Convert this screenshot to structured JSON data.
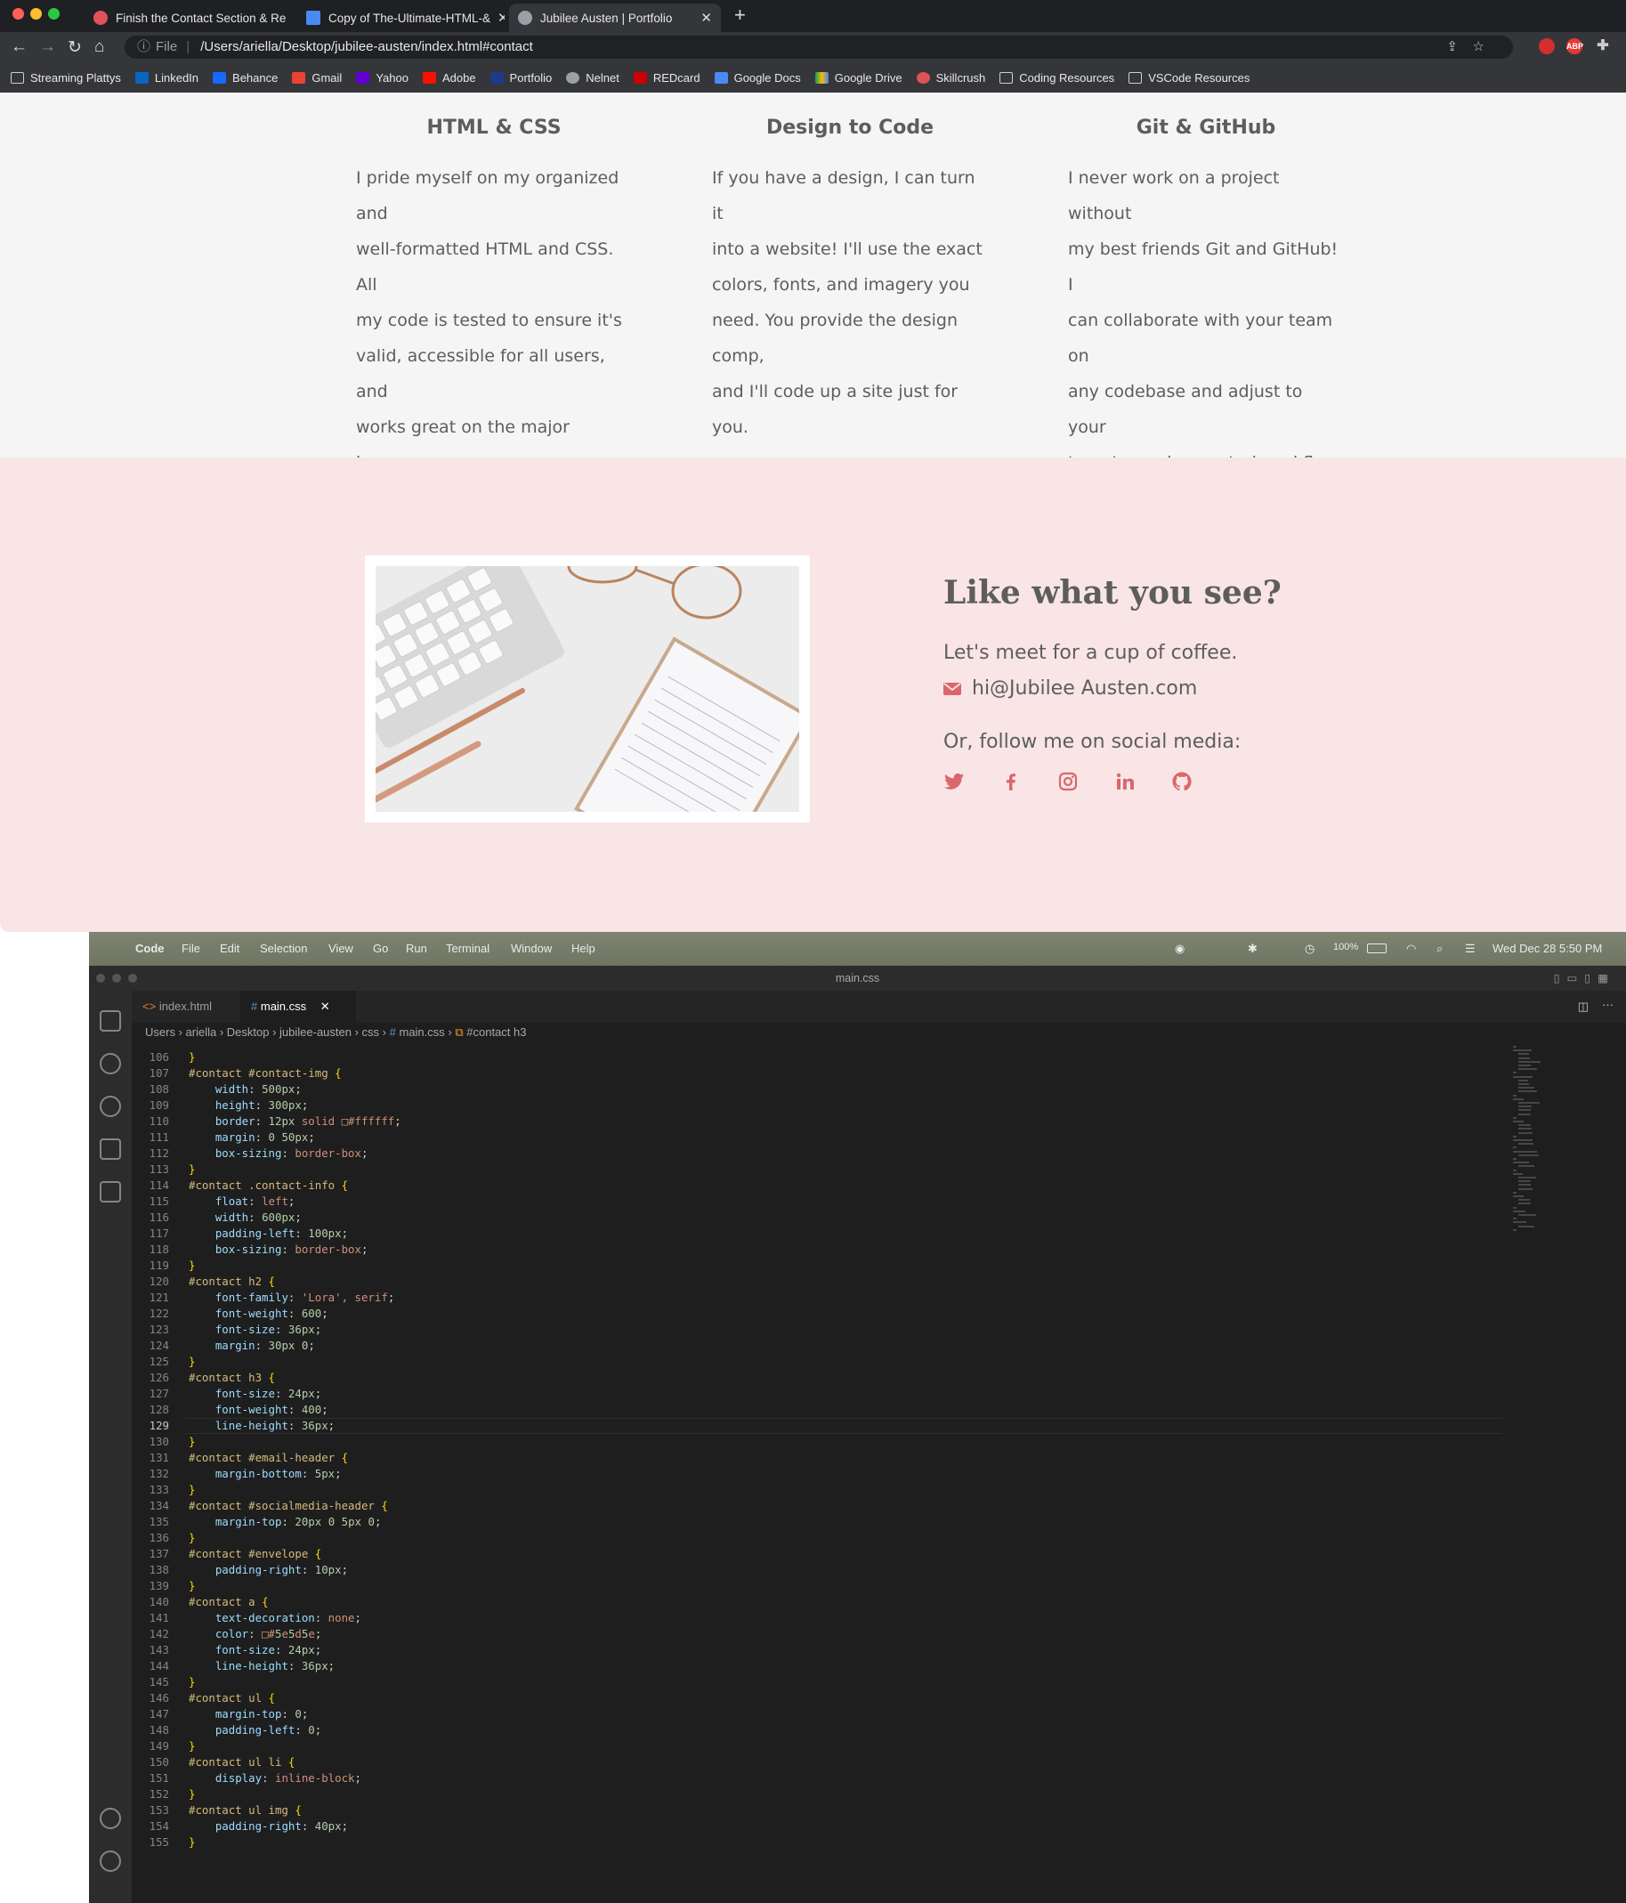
{
  "browser": {
    "tabs": [
      {
        "title": "Finish the Contact Section & Re",
        "favicon": "skillcrush-icon",
        "active": false
      },
      {
        "title": "Copy of The-Ultimate-HTML-&",
        "favicon": "google-docs-icon",
        "active": false
      },
      {
        "title": "Jubilee Austen | Portfolio",
        "favicon": "globe-icon",
        "active": true
      }
    ],
    "omnibox_label": "File",
    "url": "/Users/ariella/Desktop/jubilee-austen/index.html#contact",
    "extensions": [
      "lastpass-icon",
      "adblock-icon",
      "puzzle-icon"
    ],
    "adblock_label": "ABP",
    "bookmarks": [
      "Streaming Plattys",
      "LinkedIn",
      "Behance",
      "Gmail",
      "Yahoo",
      "Adobe",
      "Portfolio",
      "Nelnet",
      "REDcard",
      "Google Docs",
      "Google Drive",
      "Skillcrush",
      "Coding Resources",
      "VSCode Resources"
    ]
  },
  "skills": [
    {
      "title": "HTML & CSS",
      "lines": [
        "I pride myself on my organized and",
        "well-formatted HTML and CSS. All",
        "my code is tested to ensure it's",
        "valid, accessible for all users, and",
        "works great on the major browsers."
      ]
    },
    {
      "title": "Design to Code",
      "lines": [
        "If you have a design, I can turn it",
        "into a website! I'll use the exact",
        "colors, fonts, and imagery you",
        "need. You provide the design comp,",
        "and I'll code up a site just for you."
      ]
    },
    {
      "title": "Git & GitHub",
      "lines": [
        "I never work on a project without",
        "my best friends Git and GitHub! I",
        "can collaborate with your team on",
        "any codebase and adjust to your",
        "team's version control workflow."
      ]
    }
  ],
  "contact": {
    "heading": "Like what you see?",
    "coffee": "Let's meet for a cup of coffee.",
    "email": "hi@Jubilee Austen.com",
    "social_header": "Or, follow me on social media:",
    "social": [
      "twitter-icon",
      "facebook-icon",
      "instagram-icon",
      "linkedin-icon",
      "github-icon"
    ],
    "accent": "#d9676c"
  },
  "mac_menubar": {
    "items": [
      "Code",
      "File",
      "Edit",
      "Selection",
      "View",
      "Go",
      "Run",
      "Terminal",
      "Window",
      "Help"
    ],
    "battery": "100%",
    "clock": "Wed Dec 28  5:50 PM"
  },
  "vscode": {
    "window_title": "main.css",
    "tabs": [
      {
        "label": "index.html",
        "active": false
      },
      {
        "label": "main.css",
        "active": true
      }
    ],
    "breadcrumb": [
      "Users",
      "ariella",
      "Desktop",
      "jubilee-austen",
      "css",
      "main.css",
      "#contact h3"
    ],
    "code_lines": [
      {
        "n": "106",
        "t": "}"
      },
      {
        "n": "107",
        "t": "#contact #contact-img {"
      },
      {
        "n": "108",
        "t": "    width: 500px;"
      },
      {
        "n": "109",
        "t": "    height: 300px;"
      },
      {
        "n": "110",
        "t": "    border: 12px solid □#ffffff;"
      },
      {
        "n": "111",
        "t": "    margin: 0 50px;"
      },
      {
        "n": "112",
        "t": "    box-sizing: border-box;"
      },
      {
        "n": "113",
        "t": "}"
      },
      {
        "n": "114",
        "t": "#contact .contact-info {"
      },
      {
        "n": "115",
        "t": "    float: left;"
      },
      {
        "n": "116",
        "t": "    width: 600px;"
      },
      {
        "n": "117",
        "t": "    padding-left: 100px;"
      },
      {
        "n": "118",
        "t": "    box-sizing: border-box;"
      },
      {
        "n": "119",
        "t": "}"
      },
      {
        "n": "120",
        "t": "#contact h2 {"
      },
      {
        "n": "121",
        "t": "    font-family: 'Lora', serif;"
      },
      {
        "n": "122",
        "t": "    font-weight: 600;"
      },
      {
        "n": "123",
        "t": "    font-size: 36px;"
      },
      {
        "n": "124",
        "t": "    margin: 30px 0;"
      },
      {
        "n": "125",
        "t": "}"
      },
      {
        "n": "126",
        "t": "#contact h3 {"
      },
      {
        "n": "127",
        "t": "    font-size: 24px;"
      },
      {
        "n": "128",
        "t": "    font-weight: 400;"
      },
      {
        "n": "129",
        "t": "    line-height: 36px;"
      },
      {
        "n": "130",
        "t": "}"
      },
      {
        "n": "131",
        "t": "#contact #email-header {"
      },
      {
        "n": "132",
        "t": "    margin-bottom: 5px;"
      },
      {
        "n": "133",
        "t": "}"
      },
      {
        "n": "134",
        "t": "#contact #socialmedia-header {"
      },
      {
        "n": "135",
        "t": "    margin-top: 20px 0 5px 0;"
      },
      {
        "n": "136",
        "t": "}"
      },
      {
        "n": "137",
        "t": "#contact #envelope {"
      },
      {
        "n": "138",
        "t": "    padding-right: 10px;"
      },
      {
        "n": "139",
        "t": "}"
      },
      {
        "n": "140",
        "t": "#contact a {"
      },
      {
        "n": "141",
        "t": "    text-decoration: none;"
      },
      {
        "n": "142",
        "t": "    color: □#5e5d5e;"
      },
      {
        "n": "143",
        "t": "    font-size: 24px;"
      },
      {
        "n": "144",
        "t": "    line-height: 36px;"
      },
      {
        "n": "145",
        "t": "}"
      },
      {
        "n": "146",
        "t": "#contact ul {"
      },
      {
        "n": "147",
        "t": "    margin-top: 0;"
      },
      {
        "n": "148",
        "t": "    padding-left: 0;"
      },
      {
        "n": "149",
        "t": "}"
      },
      {
        "n": "150",
        "t": "#contact ul li {"
      },
      {
        "n": "151",
        "t": "    display: inline-block;"
      },
      {
        "n": "152",
        "t": "}"
      },
      {
        "n": "153",
        "t": "#contact ul img {"
      },
      {
        "n": "154",
        "t": "    padding-right: 40px;"
      },
      {
        "n": "155",
        "t": "}"
      }
    ],
    "active_line": "129"
  }
}
